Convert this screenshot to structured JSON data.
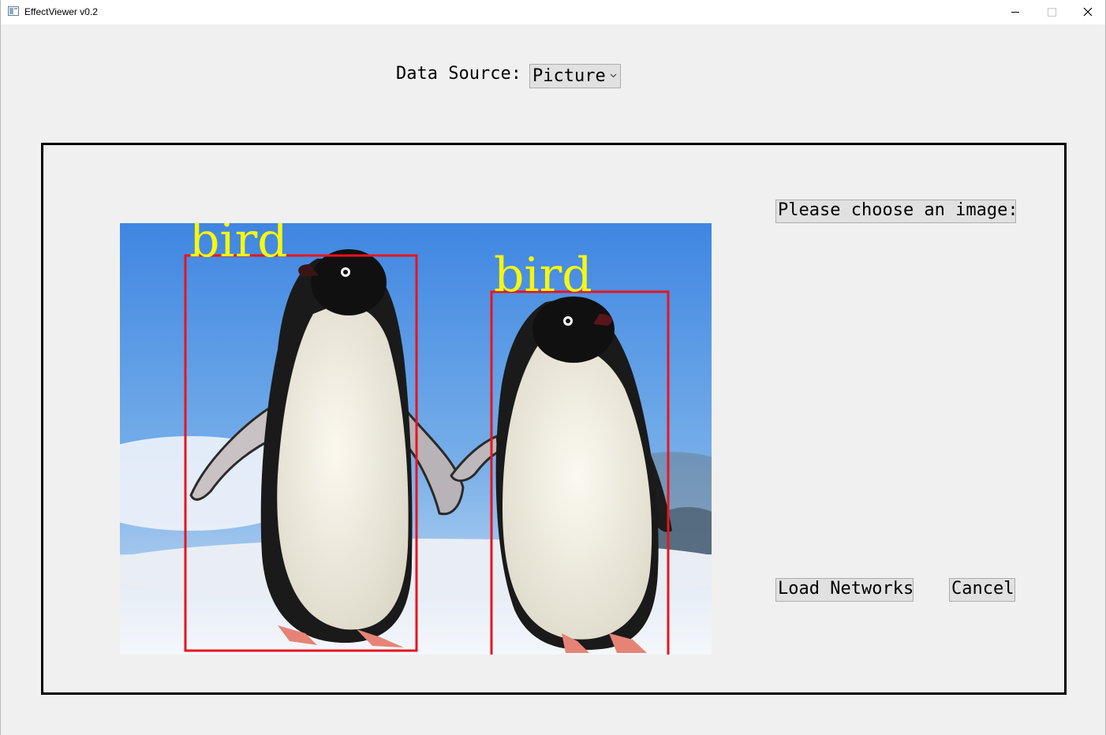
{
  "window": {
    "title": "EffectViewer v0.2"
  },
  "data_source": {
    "label": "Data Source:",
    "selected": "Picture"
  },
  "viewer": {
    "detections": [
      {
        "label": "bird",
        "box_color": "#e8141e",
        "label_color": "#f7f70e"
      },
      {
        "label": "bird",
        "box_color": "#e8141e",
        "label_color": "#f7f70e"
      }
    ]
  },
  "actions": {
    "choose_image": "Please choose an image:",
    "load_networks": "Load Networks",
    "cancel": "Cancel"
  },
  "icons": {
    "app": "app-window-icon",
    "minimize": "minimize-icon",
    "maximize": "maximize-icon",
    "close": "close-icon",
    "dropdown": "chevron-down-icon"
  }
}
